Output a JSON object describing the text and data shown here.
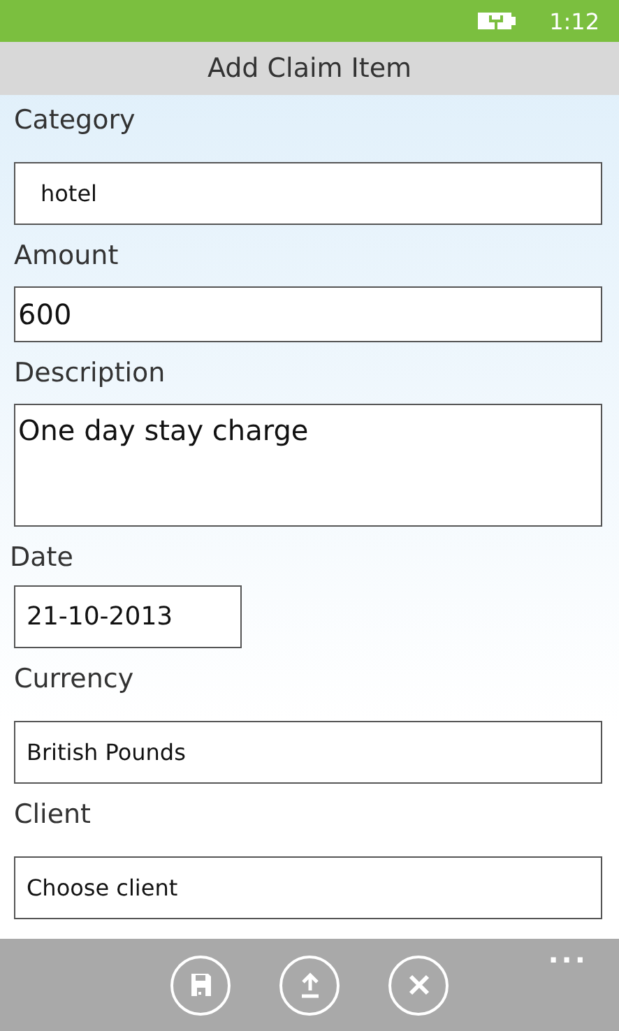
{
  "status_bar": {
    "time": "1:12"
  },
  "title": "Add Claim Item",
  "fields": [
    {
      "label": "Category",
      "kind": "picker",
      "value": "hotel"
    },
    {
      "label": "Amount",
      "kind": "text",
      "value": "600"
    },
    {
      "label": "Description",
      "kind": "multiline",
      "value": "One day stay charge"
    },
    {
      "label": "Date",
      "kind": "date",
      "value": "21-10-2013"
    },
    {
      "label": "Currency",
      "kind": "picker",
      "value": "British Pounds"
    },
    {
      "label": "Client",
      "kind": "picker",
      "value": "Choose client"
    }
  ],
  "app_bar": {
    "buttons": [
      {
        "kind": "save"
      },
      {
        "kind": "upload"
      },
      {
        "kind": "cancel"
      }
    ],
    "more": "..."
  }
}
